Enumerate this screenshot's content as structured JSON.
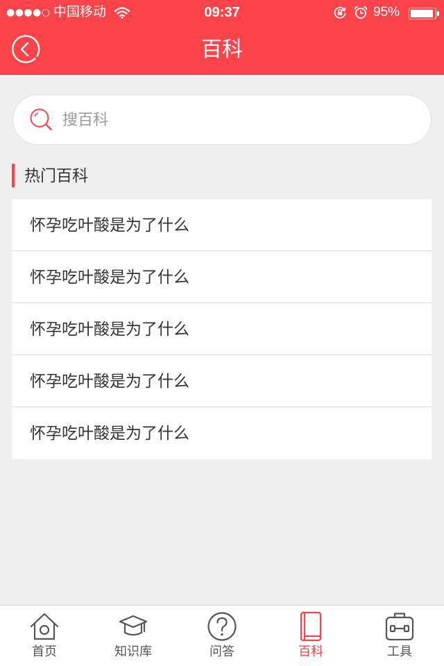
{
  "status_bar": {
    "signal": "●●●●○",
    "carrier": "中国移动",
    "time": "09:37",
    "battery_text": "95%",
    "battery_level": 0.95,
    "icons": [
      "wifi-icon",
      "orientation-lock-icon",
      "alarm-icon",
      "battery-icon"
    ]
  },
  "nav": {
    "back_icon": "back-circle-icon",
    "title": "百科"
  },
  "search": {
    "icon": "search-icon",
    "placeholder": "搜百科"
  },
  "section": {
    "title": "热门百科"
  },
  "list": {
    "items": [
      {
        "title": "怀孕吃叶酸是为了什么"
      },
      {
        "title": "怀孕吃叶酸是为了什么"
      },
      {
        "title": "怀孕吃叶酸是为了什么"
      },
      {
        "title": "怀孕吃叶酸是为了什么"
      },
      {
        "title": "怀孕吃叶酸是为了什么"
      }
    ]
  },
  "tabbar": {
    "tabs": [
      {
        "label": "首页",
        "icon": "home-icon",
        "active": false
      },
      {
        "label": "知识库",
        "icon": "graduation-cap-icon",
        "active": false
      },
      {
        "label": "问答",
        "icon": "question-circle-icon",
        "active": false
      },
      {
        "label": "百科",
        "icon": "book-icon",
        "active": true
      },
      {
        "label": "工具",
        "icon": "toolbox-icon",
        "active": false
      }
    ]
  },
  "colors": {
    "accent": "#fc4349",
    "background": "#efefef",
    "text": "#333333",
    "tab_inactive": "#555555"
  }
}
